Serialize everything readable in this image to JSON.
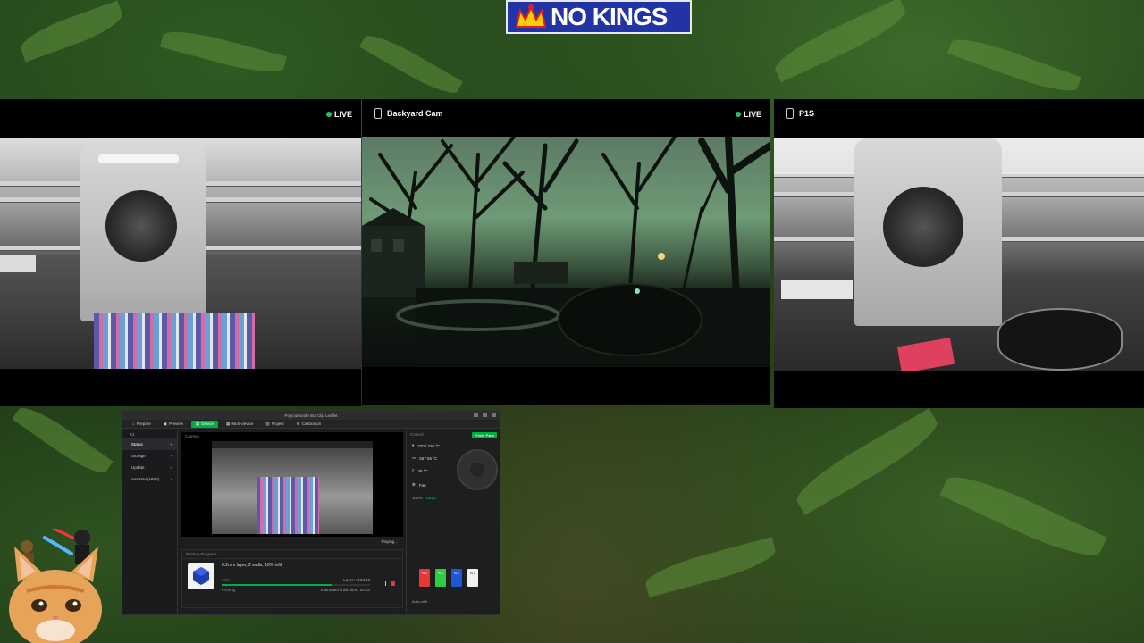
{
  "banner": {
    "text": "NO KINGS",
    "bg": "#2233a6"
  },
  "cams": {
    "left": {
      "live_label": "LIVE"
    },
    "center": {
      "name": "Backyard Cam",
      "live_label": "LIVE"
    },
    "right": {
      "name": "P1S"
    }
  },
  "studio": {
    "title": "Polycarbonite Bot Clip Leaflet",
    "tabs": [
      {
        "label": "Prepare",
        "icon": "home-icon"
      },
      {
        "label": "Preview",
        "icon": "preview-icon"
      },
      {
        "label": "Device",
        "icon": "device-icon"
      },
      {
        "label": "Multi-device",
        "icon": "multi-device-icon"
      },
      {
        "label": "Project",
        "icon": "project-icon"
      },
      {
        "label": "Calibration",
        "icon": "calibration-icon"
      }
    ],
    "device": "X1",
    "sidebar": [
      "Status",
      "Storage",
      "Update",
      "Assistant(HMS)"
    ],
    "camera_label": "Camera",
    "playing": "Playing...",
    "progress_header": "Printing Progress",
    "job_desc": "0.2mm layer, 2 walls, 10% infill",
    "percent": "74%",
    "percent_value": 74,
    "layer": "Layer: 113/150",
    "eta": "Estimated finish time: 04:24",
    "status": "Printing",
    "control_label": "Control",
    "printer_parts": "Printer Parts",
    "temps": [
      "220 / 220 °C",
      "55 / 55 °C",
      "36 °C"
    ],
    "fan_label": "Fan",
    "lamp_label": "Lamp",
    "fan_pct": "100%",
    "auto_refill": "Auto-refill",
    "spools": [
      {
        "label": "PLA",
        "color": "#e53935"
      },
      {
        "label": "PLA",
        "color": "#2ecc40"
      },
      {
        "label": "PLA",
        "color": "#1e56d6"
      },
      {
        "label": "PLA",
        "color": "#f0f0f0"
      }
    ]
  }
}
